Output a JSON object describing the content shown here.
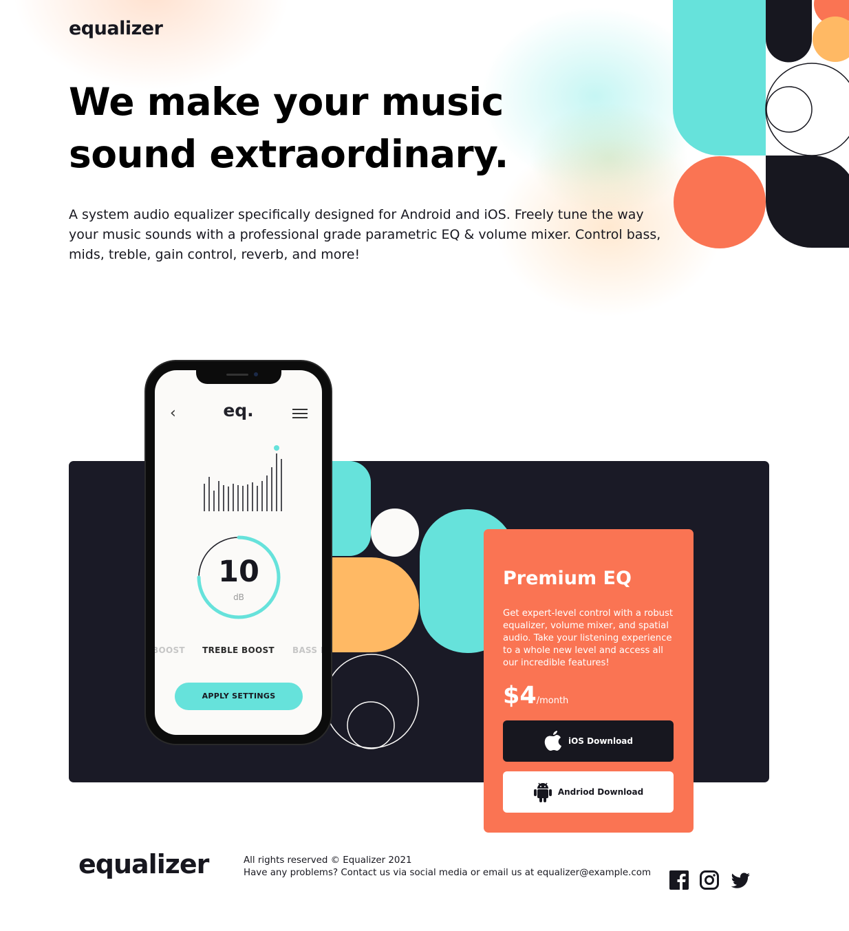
{
  "header": {
    "logo": "equalizer"
  },
  "hero": {
    "title": "We make your music sound extraordinary.",
    "description": "A system audio equalizer specifically designed for Android and iOS. Freely tune the way your music sounds with a professional grade parametric EQ & volume mixer. Control bass, mids, treble, gain control, reverb, and more!"
  },
  "phone_app": {
    "logo": "eq.",
    "back_icon": "chevron-left-icon",
    "menu_icon": "hamburger-icon",
    "dial_value": "10",
    "dial_unit": "dB",
    "dial_level": 0.75,
    "modes": [
      "BOOST",
      "TREBLE BOOST",
      "BASS B"
    ],
    "active_mode": "TREBLE BOOST",
    "apply_button": "APPLY SETTINGS"
  },
  "premium_card": {
    "title": "Premium EQ",
    "description": "Get expert-level control with a robust equalizer, volume mixer, and spatial audio. Take your listening experience to a whole new level and access all our incredible features!",
    "price": "$4",
    "price_period": "/month",
    "ios_button": "iOS Download",
    "android_button": "Andriod Download",
    "ios_icon": "apple-icon",
    "android_icon": "android-icon"
  },
  "footer": {
    "logo": "equalizer",
    "copyright": "All rights reserved © Equalizer 2021",
    "contact": "Have any problems? Contact us via social media or email us at equalizer@example.com",
    "social_icons": [
      "facebook-icon",
      "instagram-icon",
      "twitter-icon"
    ]
  },
  "colors": {
    "dark": "#17171f",
    "panel": "#1a1a26",
    "teal": "#66e2db",
    "coral": "#fa7453",
    "yellow": "#ffb964",
    "cream": "#fbfaf8"
  }
}
